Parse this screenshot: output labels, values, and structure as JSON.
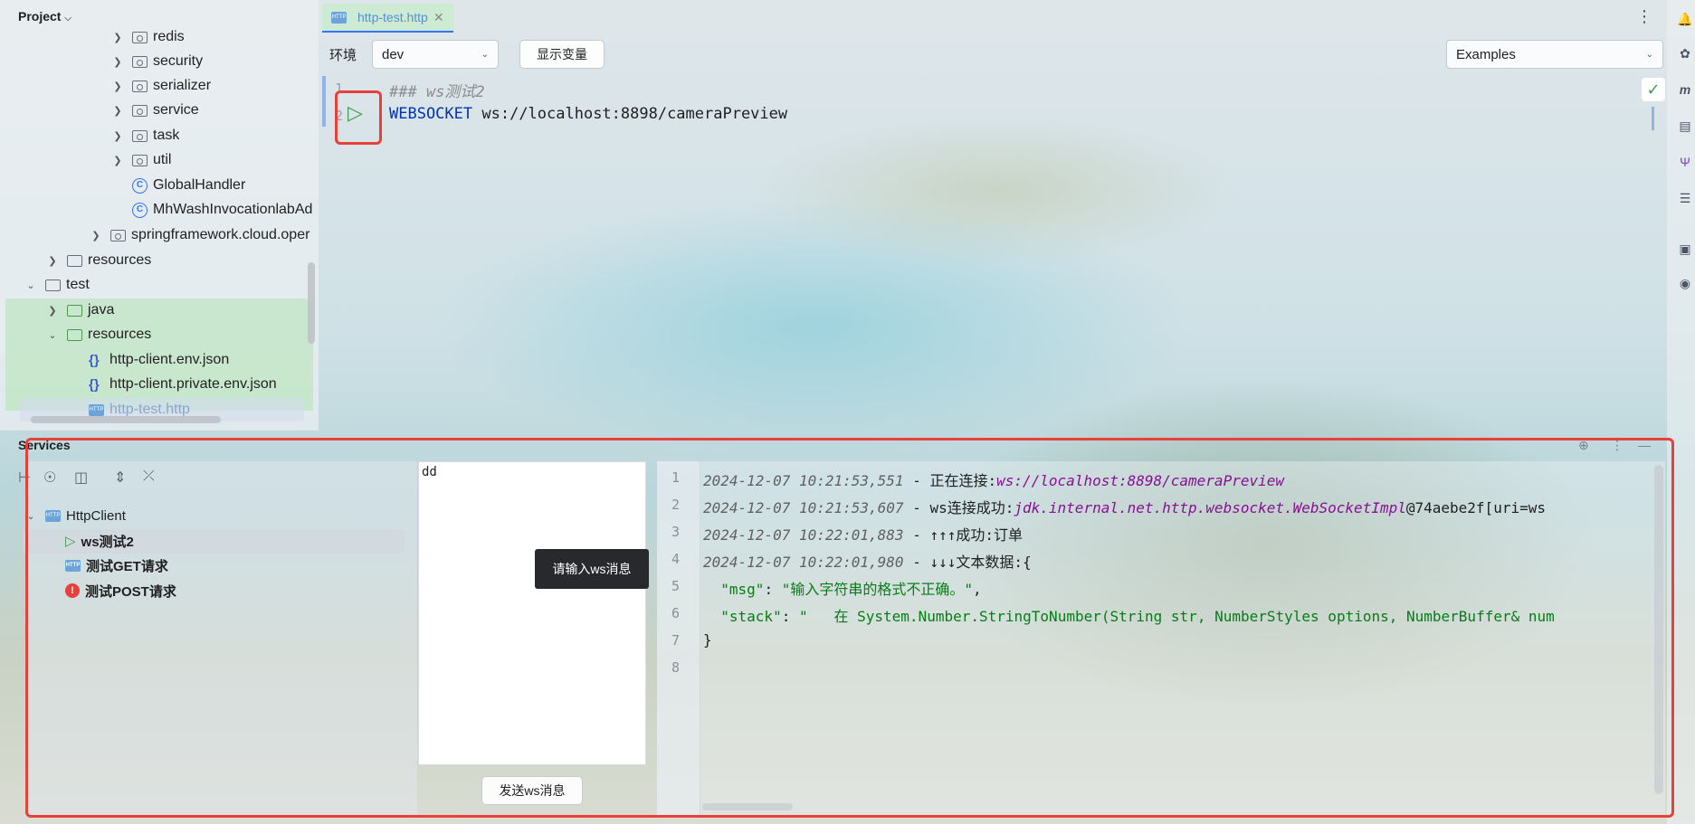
{
  "project": {
    "title": "Project",
    "items": [
      {
        "label": "redis"
      },
      {
        "label": "security"
      },
      {
        "label": "serializer"
      },
      {
        "label": "service"
      },
      {
        "label": "task"
      },
      {
        "label": "util"
      },
      {
        "label": "GlobalHandler"
      },
      {
        "label": "MhWashInvocationlabAd"
      },
      {
        "label": "springframework.cloud.oper"
      },
      {
        "label": "resources"
      },
      {
        "label": "test"
      },
      {
        "label": "java"
      },
      {
        "label": "resources"
      },
      {
        "label": "http-client.env.json"
      },
      {
        "label": "http-client.private.env.json"
      },
      {
        "label": "http-test.http"
      }
    ]
  },
  "editor": {
    "tab_label": "http-test.http",
    "env_label": "环境",
    "env_value": "dev",
    "show_vars_label": "显示变量",
    "examples_label": "Examples",
    "lines": [
      {
        "num": "1",
        "text": "### ws测试2"
      },
      {
        "num": "2",
        "keyword": "WEBSOCKET",
        "url": "ws://localhost:8898/cameraPreview"
      }
    ]
  },
  "services": {
    "title": "Services",
    "tree": [
      {
        "label": "HttpClient"
      },
      {
        "label": "ws测试2"
      },
      {
        "label": "测试GET请求"
      },
      {
        "label": "测试POST请求"
      }
    ],
    "message_input": "dd",
    "tooltip": "请输入ws消息",
    "send_button": "发送ws消息",
    "log": [
      {
        "num": "1",
        "ts": "2024-12-07 10:21:53,551",
        "sep": " - ",
        "text": "正在连接:",
        "link": "ws://localhost:8898/cameraPreview"
      },
      {
        "num": "2",
        "ts": "2024-12-07 10:21:53,607",
        "sep": " - ",
        "text": "ws连接成功:",
        "link": "jdk.internal.net.http.websocket.WebSocketImpl",
        "tail": "@74aebe2f[uri=ws"
      },
      {
        "num": "3",
        "ts": "2024-12-07 10:22:01,883",
        "sep": " - ",
        "text": "↑↑↑成功:订单"
      },
      {
        "num": "4",
        "ts": "2024-12-07 10:22:01,980",
        "sep": " - ",
        "text": "↓↓↓文本数据:{"
      },
      {
        "num": "5",
        "key": "\"msg\"",
        "colon": ": ",
        "value": "\"输入字符串的格式不正确。\"",
        "comma": ","
      },
      {
        "num": "6",
        "key": "\"stack\"",
        "colon": ": ",
        "value": "\"   在 System.Number.StringToNumber(String str, NumberStyles options, NumberBuffer& num"
      },
      {
        "num": "7",
        "text": "}"
      },
      {
        "num": "8",
        "text": ""
      }
    ]
  }
}
